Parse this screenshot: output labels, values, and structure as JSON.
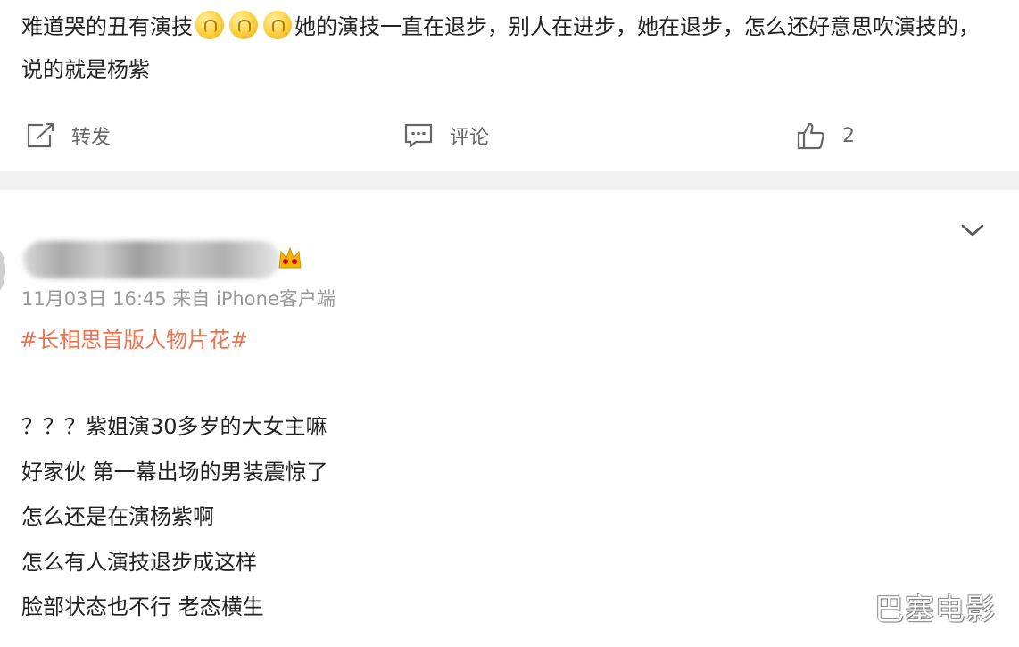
{
  "post": {
    "text_part1": "难道哭的丑有演技",
    "emoji_names": [
      "cry-emoji",
      "cry-emoji",
      "cry-emoji"
    ],
    "text_part2": "她的演技一直在退步，别人在进步，她在退步，怎么还好意思吹演技的，说的就是杨紫",
    "actions": {
      "repost_label": "转发",
      "comment_label": "评论",
      "like_count": "2"
    }
  },
  "comment": {
    "username_hidden": "blurred username",
    "meta": "11月03日 16:45 来自 iPhone客户端",
    "topic": "#长相思首版人物片花#",
    "lines": [
      "？？？紫姐演30多岁的大女主嘛",
      "好家伙 第一幕出场的男装震惊了",
      "怎么还是在演杨紫啊",
      "怎么有人演技退步成这样",
      "脸部状态也不行 老态横生"
    ]
  },
  "watermark": "巴塞电影",
  "colors": {
    "topic": "#eb7350",
    "meta": "#999999",
    "divider_bg": "#f1f1f1"
  }
}
